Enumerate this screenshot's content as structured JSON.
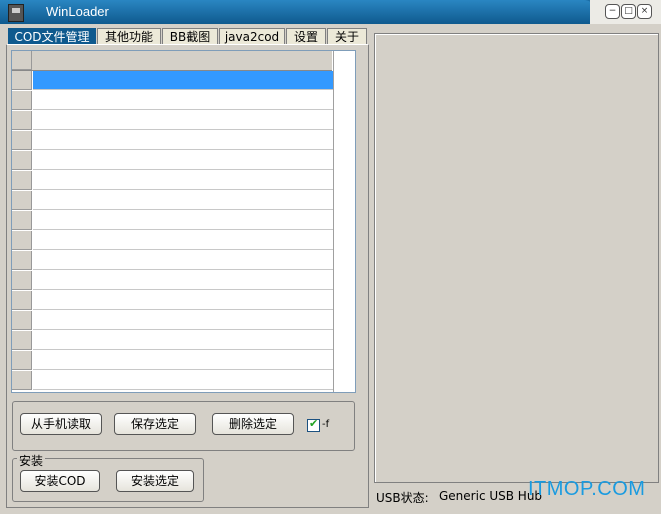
{
  "window": {
    "title": "WinLoader",
    "buttons": [
      "minimize",
      "maximize",
      "close"
    ]
  },
  "tabs": [
    {
      "label": "COD文件管理",
      "active": true
    },
    {
      "label": "其他功能",
      "active": false
    },
    {
      "label": "BB截图",
      "active": false
    },
    {
      "label": "java2cod",
      "active": false
    },
    {
      "label": "设置",
      "active": false
    },
    {
      "label": "关于",
      "active": false
    }
  ],
  "grid": {
    "rows": 16,
    "selected_row": 0
  },
  "actions": {
    "read_from_phone": "从手机读取",
    "save_selected": "保存选定",
    "delete_selected": "删除选定",
    "checkbox_label": "-f",
    "checkbox_checked": true
  },
  "install": {
    "group_label": "安装",
    "install_cod": "安装COD",
    "install_selected": "安装选定"
  },
  "status": {
    "usb_label": "USB状态:",
    "usb_value": "Generic USB Hub"
  },
  "watermark": "ITMOP.COM",
  "colors": {
    "title_bar": "#0f5a8e",
    "selection": "#3399ff",
    "watermark": "#1a9be0"
  }
}
